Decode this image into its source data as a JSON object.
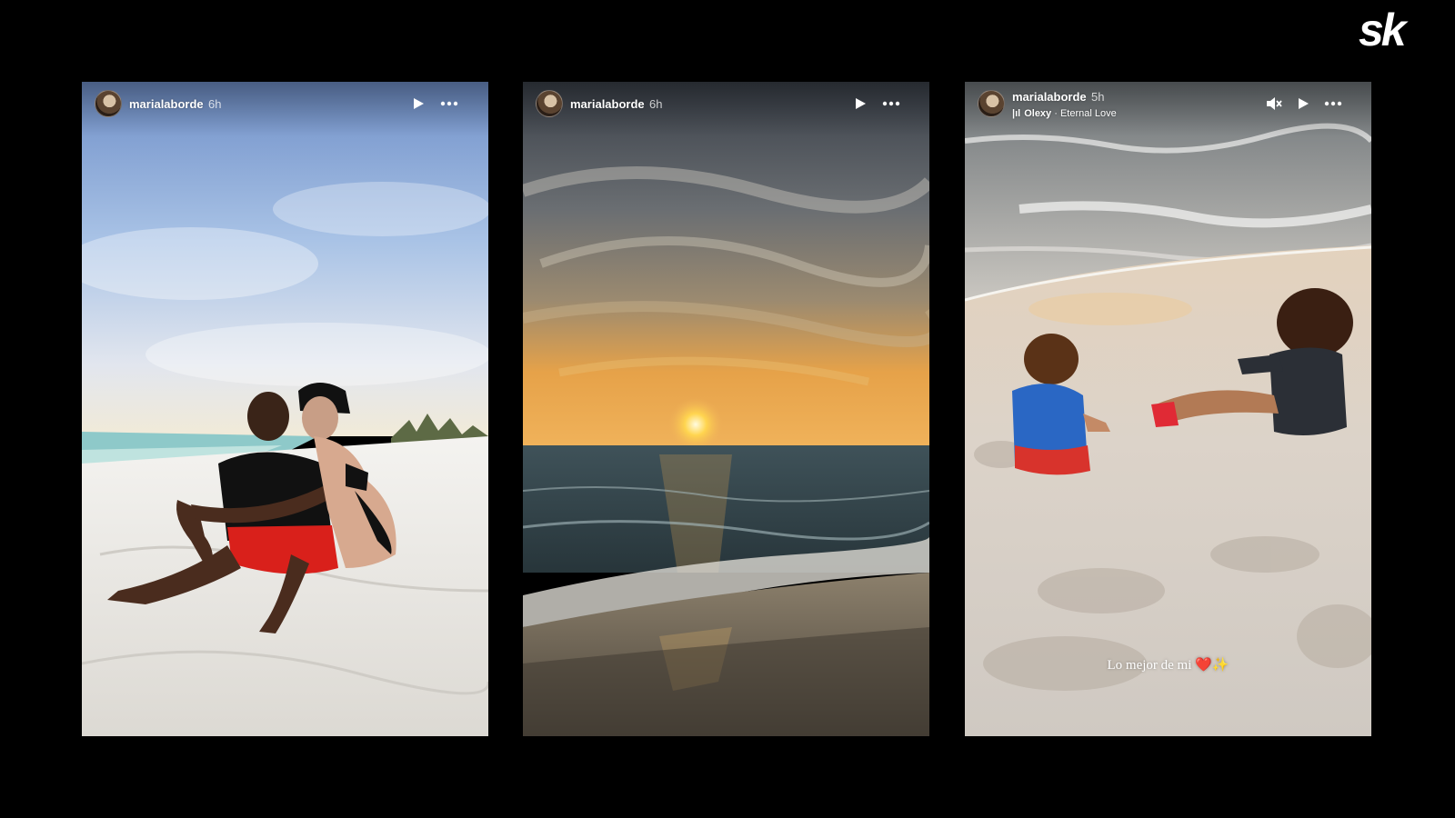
{
  "brand": {
    "logo_text": "sk"
  },
  "stories": [
    {
      "username": "marialaborde",
      "time": "6h",
      "controls": [
        "play-icon",
        "more-options-icon"
      ]
    },
    {
      "username": "marialaborde",
      "time": "6h",
      "controls": [
        "play-icon",
        "more-options-icon"
      ]
    },
    {
      "username": "marialaborde",
      "time": "5h",
      "music": {
        "artist": "Olexy",
        "separator": " · ",
        "title": "Eternal Love"
      },
      "caption": "Lo mejor de mi ❤️✨",
      "controls": [
        "mute-icon",
        "play-icon",
        "more-options-icon"
      ]
    }
  ],
  "colors": {
    "background": "#000000",
    "text": "#ffffff"
  }
}
